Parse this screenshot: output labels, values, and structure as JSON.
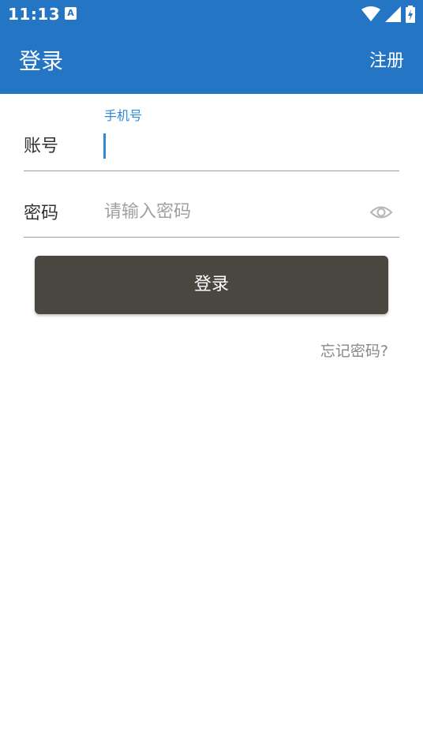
{
  "status_bar": {
    "time": "11:13",
    "notification_icon": "A",
    "icons": [
      "wifi-icon",
      "cell-signal-icon",
      "battery-charging-icon"
    ]
  },
  "app_bar": {
    "title": "登录",
    "action_label": "注册",
    "background_color": "#2476c4"
  },
  "form": {
    "account": {
      "label": "账号",
      "floating_hint": "手机号",
      "value": ""
    },
    "password": {
      "label": "密码",
      "placeholder": "请输入密码",
      "value": ""
    },
    "login_button_label": "登录",
    "forgot_password_label": "忘记密码?",
    "accent_color": "#2f89d8",
    "button_color": "#4a4741"
  }
}
